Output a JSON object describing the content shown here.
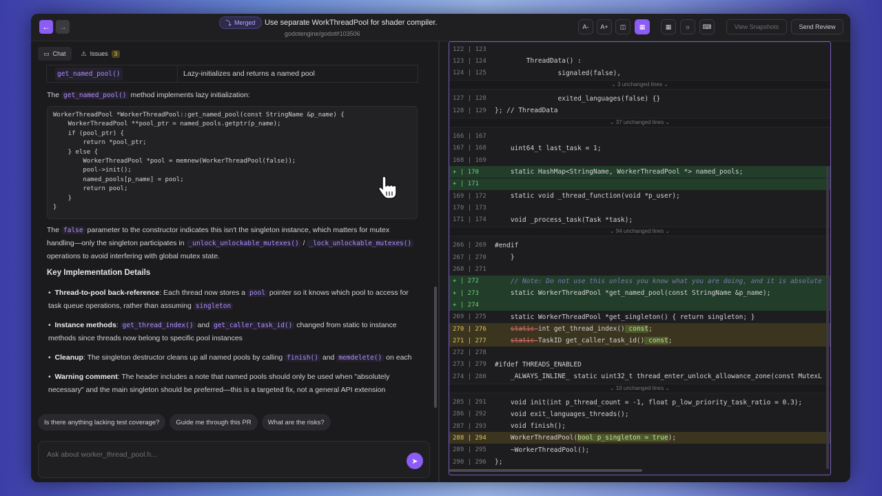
{
  "header": {
    "status_badge": "Merged",
    "pr_title": "Use separate WorkThreadPool for shader compiler.",
    "pr_ref": "godotengine/godot#103506",
    "font_smaller": "A-",
    "font_larger": "A+",
    "view_snapshots": "View Snapshots",
    "send_review": "Send Review"
  },
  "tabs": {
    "chat": "Chat",
    "issues": "Issues",
    "issues_count": "3"
  },
  "chat": {
    "table_row": {
      "method": "get_named_pool()",
      "desc": "Lazy-initializes and returns a named pool"
    },
    "para1_a": "The",
    "para1_code": "get_named_pool()",
    "para1_b": "method implements lazy initialization:",
    "code_lines": [
      "WorkerThreadPool *WorkerThreadPool::get_named_pool(const StringName &p_name) {",
      "    WorkerThreadPool **pool_ptr = named_pools.getptr(p_name);",
      "    if (pool_ptr) {",
      "        return *pool_ptr;",
      "    } else {",
      "        WorkerThreadPool *pool = memnew(WorkerThreadPool(false));",
      "        pool->init();",
      "        named_pools[p_name] = pool;",
      "        return pool;",
      "    }",
      "}"
    ],
    "para2_a": "The",
    "para2_code1": "false",
    "para2_b": "parameter to the constructor indicates this isn't the singleton instance, which matters for mutex",
    "para2_c": "handling—only the singleton participates in",
    "para2_code2": "_unlock_unlockable_mutexes()",
    "para2_slash": "/",
    "para2_code3": "_lock_unlockable_mutexes()",
    "para2_d": "operations to avoid interfering with global mutex state.",
    "heading": "Key Implementation Details",
    "b1_title": "Thread-to-pool back-reference",
    "b1_a": ": Each thread now stores a",
    "b1_code": "pool",
    "b1_b": "pointer so it knows which pool to access for",
    "b1_c": "task queue operations, rather than assuming",
    "b1_code2": "singleton",
    "b2_title": "Instance methods",
    "b2_colon": ":",
    "b2_code1": "get_thread_index()",
    "b2_and": "and",
    "b2_code2": "get_caller_task_id()",
    "b2_a": "changed from static to instance",
    "b2_b": "methods since threads now belong to specific pool instances",
    "b3_title": "Cleanup",
    "b3_a": ": The singleton destructor cleans up all named pools by calling",
    "b3_code1": "finish()",
    "b3_and": "and",
    "b3_code2": "memdelete()",
    "b3_b": "on each",
    "b4_title": "Warning comment",
    "b4_a": ": The header includes a note that named pools should only be used when \"absolutely",
    "b4_b": "necessary\" and the main singleton should be preferred—this is a targeted fix, not a general API extension"
  },
  "suggestions": [
    "Is there anything lacking test coverage?",
    "Guide me through this PR",
    "What are the risks?"
  ],
  "ask": {
    "placeholder": "Ask about worker_thread_pool.h..."
  },
  "diff": {
    "rows": [
      {
        "type": "ctx",
        "old": "122",
        "new": "123",
        "code": ""
      },
      {
        "type": "ctx",
        "old": "123",
        "new": "124",
        "code": "        ThreadData() :"
      },
      {
        "type": "ctx",
        "old": "124",
        "new": "125",
        "code": "                signaled(false),"
      },
      {
        "type": "sep",
        "label": "3 unchanged lines"
      },
      {
        "type": "ctx",
        "old": "127",
        "new": "128",
        "code": "                exited_languages(false) {}"
      },
      {
        "type": "ctx",
        "old": "128",
        "new": "129",
        "code": "}; // ThreadData"
      },
      {
        "type": "sep",
        "label": "37 unchanged lines"
      },
      {
        "type": "ctx",
        "old": "166",
        "new": "167",
        "code": ""
      },
      {
        "type": "ctx",
        "old": "167",
        "new": "168",
        "code": "    uint64_t last_task = 1;"
      },
      {
        "type": "ctx",
        "old": "168",
        "new": "169",
        "code": ""
      },
      {
        "type": "add",
        "old": "+",
        "new": "170",
        "code": "    static HashMap<StringName, WorkerThreadPool *> named_pools;"
      },
      {
        "type": "add",
        "old": "+",
        "new": "171",
        "code": ""
      },
      {
        "type": "ctx",
        "old": "169",
        "new": "172",
        "code": "    static void _thread_function(void *p_user);"
      },
      {
        "type": "ctx",
        "old": "170",
        "new": "173",
        "code": ""
      },
      {
        "type": "ctx",
        "old": "171",
        "new": "174",
        "code": "    void _process_task(Task *task);"
      },
      {
        "type": "sep",
        "label": "94 unchanged lines"
      },
      {
        "type": "ctx",
        "old": "266",
        "new": "269",
        "code": "#endif"
      },
      {
        "type": "ctx",
        "old": "267",
        "new": "270",
        "code": "    }"
      },
      {
        "type": "ctx",
        "old": "268",
        "new": "271",
        "code": ""
      },
      {
        "type": "add",
        "old": "+",
        "new": "272",
        "code": "    // Note: Do not use this unless you know what you are doing, and it is absolute"
      },
      {
        "type": "add",
        "old": "+",
        "new": "273",
        "code": "    static WorkerThreadPool *get_named_pool(const StringName &p_name);"
      },
      {
        "type": "add",
        "old": "+",
        "new": "274",
        "code": ""
      },
      {
        "type": "ctx",
        "old": "269",
        "new": "275",
        "code": "    static WorkerThreadPool *get_singleton() { return singleton; }"
      },
      {
        "type": "mod",
        "old": "270",
        "new": "276",
        "del": "static ",
        "code": "int get_thread_index()",
        "hl": " const",
        ";": ";"
      },
      {
        "type": "mod",
        "old": "271",
        "new": "277",
        "del": "static ",
        "code": "TaskID get_caller_task_id()",
        "hl": " const",
        ";": ";"
      },
      {
        "type": "ctx",
        "old": "272",
        "new": "278",
        "code": ""
      },
      {
        "type": "ctx",
        "old": "273",
        "new": "279",
        "code": "#ifdef THREADS_ENABLED"
      },
      {
        "type": "ctx",
        "old": "274",
        "new": "280",
        "code": "    _ALWAYS_INLINE_ static uint32_t thread_enter_unlock_allowance_zone(const MutexL"
      },
      {
        "type": "sep",
        "label": "10 unchanged lines"
      },
      {
        "type": "ctx",
        "old": "285",
        "new": "291",
        "code": "    void init(int p_thread_count = -1, float p_low_priority_task_ratio = 0.3);"
      },
      {
        "type": "ctx",
        "old": "286",
        "new": "292",
        "code": "    void exit_languages_threads();"
      },
      {
        "type": "ctx",
        "old": "287",
        "new": "293",
        "code": "    void finish();"
      },
      {
        "type": "mod2",
        "old": "288",
        "new": "294",
        "code_a": "    WorkerThreadPool(",
        "hl": "bool p_singleton = true",
        "code_b": ");"
      },
      {
        "type": "ctx",
        "old": "289",
        "new": "295",
        "code": "    ~WorkerThreadPool();"
      },
      {
        "type": "ctx",
        "old": "290",
        "new": "296",
        "code": "};"
      }
    ]
  }
}
